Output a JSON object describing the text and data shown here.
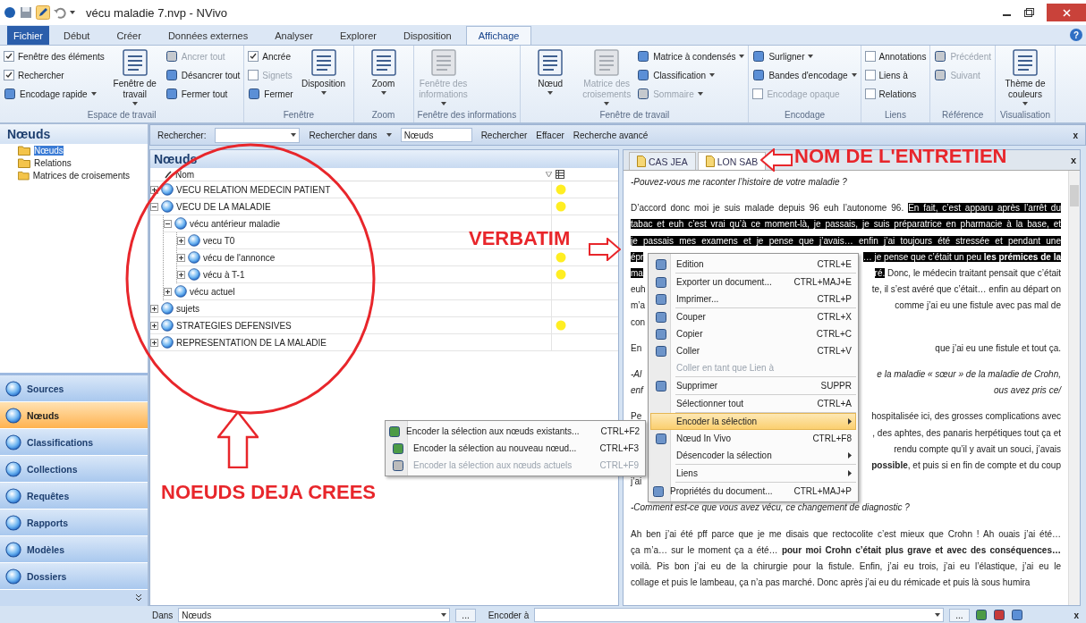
{
  "window": {
    "title": "vécu maladie 7.nvp - NVivo",
    "help": "?"
  },
  "tabs": [
    {
      "label": "Fichier",
      "kind": "file",
      "selected": false
    },
    {
      "label": "Début",
      "kind": "tab",
      "selected": false
    },
    {
      "label": "Créer",
      "kind": "tab",
      "selected": false
    },
    {
      "label": "Données externes",
      "kind": "tab",
      "selected": false
    },
    {
      "label": "Analyser",
      "kind": "tab",
      "selected": false
    },
    {
      "label": "Explorer",
      "kind": "tab",
      "selected": false
    },
    {
      "label": "Disposition",
      "kind": "tab",
      "selected": false
    },
    {
      "label": "Affichage",
      "kind": "tab",
      "selected": true
    }
  ],
  "ribbon": [
    {
      "label": "Espace de travail",
      "items": [
        {
          "kind": "check",
          "label": "Fenêtre des éléments",
          "checked": true,
          "disabled": false
        },
        {
          "kind": "check",
          "label": "Rechercher",
          "checked": true,
          "disabled": false
        },
        {
          "kind": "small",
          "label": "Encodage rapide",
          "dropdown": true,
          "disabled": false
        },
        {
          "kind": "large",
          "label": "Fenêtre de travail",
          "dropdown": true,
          "disabled": false
        },
        {
          "kind": "small",
          "label": "Ancrer tout",
          "dropdown": false,
          "disabled": true
        },
        {
          "kind": "small",
          "label": "Désancrer tout",
          "dropdown": false,
          "disabled": false
        },
        {
          "kind": "small",
          "label": "Fermer tout",
          "dropdown": false,
          "disabled": false
        }
      ]
    },
    {
      "label": "Fenêtre",
      "items": [
        {
          "kind": "check",
          "label": "Ancrée",
          "checked": true,
          "disabled": false
        },
        {
          "kind": "check",
          "label": "Signets",
          "checked": false,
          "disabled": true
        },
        {
          "kind": "small",
          "label": "Fermer",
          "dropdown": false,
          "disabled": false
        },
        {
          "kind": "large",
          "label": "Disposition",
          "dropdown": true,
          "disabled": false
        }
      ]
    },
    {
      "label": "Zoom",
      "items": [
        {
          "kind": "large",
          "label": "Zoom",
          "dropdown": true,
          "disabled": false
        }
      ]
    },
    {
      "label": "Fenêtre des informations",
      "items": [
        {
          "kind": "large",
          "label": "Fenêtre des informations",
          "dropdown": true,
          "disabled": true
        }
      ]
    },
    {
      "label": "Fenêtre de travail",
      "items": [
        {
          "kind": "large",
          "label": "Nœud",
          "dropdown": true,
          "disabled": false
        },
        {
          "kind": "large",
          "label": "Matrice des croisements",
          "dropdown": true,
          "disabled": true
        },
        {
          "kind": "small",
          "label": "Matrice à condensés",
          "dropdown": true,
          "disabled": false
        },
        {
          "kind": "small",
          "label": "Classification",
          "dropdown": true,
          "disabled": false
        },
        {
          "kind": "small",
          "label": "Sommaire",
          "dropdown": true,
          "disabled": true
        }
      ]
    },
    {
      "label": "Encodage",
      "items": [
        {
          "kind": "small",
          "label": "Surligner",
          "dropdown": true,
          "disabled": false
        },
        {
          "kind": "small",
          "label": "Bandes d'encodage",
          "dropdown": true,
          "disabled": false
        },
        {
          "kind": "check",
          "label": "Encodage opaque",
          "checked": false,
          "disabled": true
        }
      ]
    },
    {
      "label": "Liens",
      "items": [
        {
          "kind": "check",
          "label": "Annotations",
          "checked": false,
          "disabled": false
        },
        {
          "kind": "check",
          "label": "Liens à",
          "checked": false,
          "disabled": false
        },
        {
          "kind": "check",
          "label": "Relations",
          "checked": false,
          "disabled": false
        }
      ]
    },
    {
      "label": "Référence",
      "items": [
        {
          "kind": "small",
          "label": "Précédent",
          "dropdown": false,
          "disabled": true
        },
        {
          "kind": "small",
          "label": "Suivant",
          "dropdown": false,
          "disabled": true
        }
      ]
    },
    {
      "label": "Visualisation",
      "items": [
        {
          "kind": "large",
          "label": "Thème de couleurs",
          "dropdown": true,
          "disabled": false
        }
      ]
    }
  ],
  "sidebar": {
    "title": "Nœuds",
    "items": [
      {
        "label": "Nœuds",
        "selected": true
      },
      {
        "label": "Relations",
        "selected": false
      },
      {
        "label": "Matrices de croisements",
        "selected": false
      }
    ],
    "nav": [
      {
        "label": "Sources",
        "selected": false
      },
      {
        "label": "Nœuds",
        "selected": true
      },
      {
        "label": "Classifications",
        "selected": false
      },
      {
        "label": "Collections",
        "selected": false
      },
      {
        "label": "Requêtes",
        "selected": false
      },
      {
        "label": "Rapports",
        "selected": false
      },
      {
        "label": "Modèles",
        "selected": false
      },
      {
        "label": "Dossiers",
        "selected": false
      }
    ]
  },
  "search": {
    "label": "Rechercher:",
    "look_in": "Rechercher dans",
    "scope": "Nœuds",
    "buttons": [
      "Rechercher",
      "Effacer",
      "Recherche avancé"
    ],
    "close": "x"
  },
  "tree": {
    "title": "Nœuds",
    "column": "Nom",
    "nodes": [
      {
        "name": "VECU RELATION MEDECIN PATIENT",
        "expanded": false,
        "has_marker": true
      },
      {
        "name": "VECU DE LA MALADIE",
        "expanded": true,
        "has_marker": true,
        "children": [
          {
            "name": "vécu antérieur maladie",
            "expanded": true,
            "has_marker": false,
            "children": [
              {
                "name": "vecu T0",
                "expanded": false,
                "has_marker": false
              },
              {
                "name": "vécu de l'annonce",
                "expanded": false,
                "has_marker": true
              },
              {
                "name": "vécu à T-1",
                "expanded": false,
                "has_marker": true
              }
            ]
          },
          {
            "name": "vécu actuel",
            "expanded": false,
            "has_marker": false
          }
        ]
      },
      {
        "name": "sujets",
        "expanded": false,
        "has_marker": false
      },
      {
        "name": "STRATEGIES DEFENSIVES",
        "expanded": false,
        "has_marker": true
      },
      {
        "name": "REPRESENTATION DE LA MALADIE",
        "expanded": false,
        "has_marker": false
      }
    ]
  },
  "doc": {
    "tabs": [
      {
        "label": "CAS JEA",
        "selected": false
      },
      {
        "label": "LON SAB",
        "selected": true
      }
    ],
    "close": "x",
    "paragraphs": [
      {
        "italic": true,
        "lines": [
          {
            "left": [
              {
                "text": "-Pouvez-vous me raconter l’histoire de votre maladie ?",
                "highlighted": false
              }
            ]
          }
        ]
      },
      {
        "italic": false,
        "lines": [
          {
            "left": [
              {
                "text": "D’accord donc moi je suis malade depuis 96 euh l’autonome 96. ",
                "highlighted": false
              },
              {
                "text": "En fait, c’est apparu après l’arrêt du",
                "highlighted": true
              }
            ]
          },
          {
            "left": [
              {
                "text": "tabac et euh c’est vrai qu’à ce moment-là, je passais, je suis préparatrice en pharmacie à la base, et",
                "highlighted": true
              }
            ]
          },
          {
            "left": [
              {
                "text": "je passais mes examens et je pense que j’avais… enfin j’ai toujours été stressée et pendant une",
                "highlighted": true
              }
            ]
          },
          {
            "left": [
              {
                "text": "épr",
                "highlighted": true
              }
            ],
            "right": [
              {
                "text": "… je pense que c’était un peu **les prémices de la**",
                "highlighted": true
              }
            ]
          },
          {
            "left": [
              {
                "text": "ma",
                "highlighted": true
              }
            ],
            "right": [
              {
                "text": "ré.",
                "highlighted": true
              },
              {
                "text": " Donc, le médecin traitant pensait que c’était",
                "highlighted": false
              }
            ]
          },
          {
            "left": [
              {
                "text": "euh",
                "highlighted": false
              }
            ],
            "right": [
              {
                "text": "te, il s’est avéré que c’était… enfin au départ on",
                "highlighted": false
              }
            ]
          },
          {
            "left": [
              {
                "text": "m’a",
                "highlighted": false
              }
            ],
            "right": [
              {
                "text": "comme j’ai eu une fistule avec pas mal de",
                "highlighted": false
              }
            ]
          },
          {
            "left": [
              {
                "text": "con",
                "highlighted": false
              }
            ]
          }
        ]
      },
      {
        "italic": false,
        "lines": [
          {
            "left": [
              {
                "text": "En",
                "highlighted": false
              }
            ],
            "right": [
              {
                "text": "que j’ai eu une fistule et tout ça.",
                "highlighted": false
              }
            ]
          }
        ]
      },
      {
        "italic": true,
        "lines": [
          {
            "left": [
              {
                "text": "-Al",
                "highlighted": false
              }
            ],
            "right": [
              {
                "text": "e la maladie « sœur » de la maladie de Crohn,",
                "highlighted": false
              }
            ]
          },
          {
            "left": [
              {
                "text": "enf",
                "highlighted": false
              }
            ],
            "right": [
              {
                "text": "ous avez pris ce/",
                "highlighted": false
              }
            ]
          }
        ]
      },
      {
        "italic": false,
        "lines": [
          {
            "left": [
              {
                "text": "Pe",
                "highlighted": false
              }
            ],
            "right": [
              {
                "text": "hospitalisée ici, des grosses complications avec",
                "highlighted": false
              }
            ]
          },
          {
            "right": [
              {
                "text": ", des aphtes, des panaris herpétiques tout ça et",
                "highlighted": false
              }
            ]
          },
          {
            "right": [
              {
                "text": "rendu compte qu’il y avait un souci, j’avais",
                "highlighted": false
              }
            ]
          },
          {
            "right": [
              {
                "text": "**possible**, et puis si en fin de compte et du coup",
                "highlighted": false
              }
            ]
          },
          {
            "left": [
              {
                "text": "j’ai",
                "highlighted": false
              }
            ]
          }
        ]
      },
      {
        "italic": true,
        "lines": [
          {
            "left": [
              {
                "text": "-Comment est-ce que vous avez vécu, ce changement de diagnostic ?",
                "highlighted": false
              }
            ]
          }
        ]
      },
      {
        "italic": false,
        "lines": [
          {
            "left": [
              {
                "text": "Ah ben j’ai été pff parce que je me disais que rectocolite c’est mieux que Crohn ! Ah ouais j’ai été…",
                "highlighted": false
              }
            ]
          },
          {
            "left": [
              {
                "text": "ça m’a… sur le moment ça a été… **pour moi Crohn c’était plus grave et avec des conséquences…**",
                "highlighted": false
              }
            ]
          },
          {
            "left": [
              {
                "text": "voilà. Pis bon j’ai eu de la chirurgie pour la fistule. Enfin, j’ai eu trois, j’ai eu l’élastique, j’ai eu le",
                "highlighted": false
              }
            ]
          },
          {
            "left": [
              {
                "text": "collage et puis le lambeau, ça n’a pas marché. Donc après j’ai eu du rémicade et puis là sous humira",
                "highlighted": false
              }
            ]
          }
        ]
      }
    ]
  },
  "context_menu": [
    {
      "label": "Edition",
      "shortcut": "CTRL+E",
      "has_icon": true,
      "disabled": false,
      "submenu": false,
      "selected": false,
      "separator_before": false
    },
    {
      "label": "Exporter un document...",
      "shortcut": "CTRL+MAJ+E",
      "has_icon": true,
      "disabled": false,
      "submenu": false,
      "selected": false,
      "separator_before": true
    },
    {
      "label": "Imprimer...",
      "shortcut": "CTRL+P",
      "has_icon": true,
      "disabled": false,
      "submenu": false,
      "selected": false,
      "separator_before": false
    },
    {
      "label": "Couper",
      "shortcut": "CTRL+X",
      "has_icon": true,
      "disabled": false,
      "submenu": false,
      "selected": false,
      "separator_before": true
    },
    {
      "label": "Copier",
      "shortcut": "CTRL+C",
      "has_icon": true,
      "disabled": false,
      "submenu": false,
      "selected": false,
      "separator_before": false
    },
    {
      "label": "Coller",
      "shortcut": "CTRL+V",
      "has_icon": true,
      "disabled": false,
      "submenu": false,
      "selected": false,
      "separator_before": false
    },
    {
      "label": "Coller en tant que Lien à",
      "has_icon": false,
      "disabled": true,
      "submenu": false,
      "selected": false,
      "separator_before": false
    },
    {
      "label": "Supprimer",
      "shortcut": "SUPPR",
      "has_icon": true,
      "disabled": false,
      "submenu": false,
      "selected": false,
      "separator_before": true
    },
    {
      "label": "Sélectionner tout",
      "shortcut": "CTRL+A",
      "has_icon": false,
      "disabled": false,
      "submenu": false,
      "selected": false,
      "separator_before": true
    },
    {
      "label": "Encoder la sélection",
      "has_icon": false,
      "disabled": false,
      "submenu": true,
      "selected": true,
      "separator_before": true
    },
    {
      "label": "Nœud In Vivo",
      "shortcut": "CTRL+F8",
      "has_icon": true,
      "disabled": false,
      "submenu": false,
      "selected": false,
      "separator_before": false
    },
    {
      "label": "Désencoder la sélection",
      "has_icon": false,
      "disabled": false,
      "submenu": true,
      "selected": false,
      "separator_before": false
    },
    {
      "label": "Liens",
      "has_icon": false,
      "disabled": false,
      "submenu": true,
      "selected": false,
      "separator_before": true
    },
    {
      "label": "Propriétés du document...",
      "shortcut": "CTRL+MAJ+P",
      "has_icon": true,
      "disabled": false,
      "submenu": false,
      "selected": false,
      "separator_before": true
    }
  ],
  "submenu": [
    {
      "label": "Encoder la sélection aux nœuds existants...",
      "shortcut": "CTRL+F2",
      "disabled": false
    },
    {
      "label": "Encoder la sélection au nouveau nœud...",
      "shortcut": "CTRL+F3",
      "disabled": false
    },
    {
      "label": "Encoder la sélection aux nœuds actuels",
      "shortcut": "CTRL+F9",
      "disabled": true
    }
  ],
  "bottom_bar": {
    "in_label": "Dans",
    "in_value": "Nœuds",
    "browse": [
      "...",
      "..."
    ],
    "code_label": "Encoder à",
    "close": "x"
  },
  "annotations": [
    {
      "text": "NOM DE L'ENTRETIEN",
      "kind": "left"
    },
    {
      "text": "VERBATIM",
      "kind": "right"
    },
    {
      "text": "NOEUDS DEJA CREES",
      "kind": "up"
    }
  ]
}
